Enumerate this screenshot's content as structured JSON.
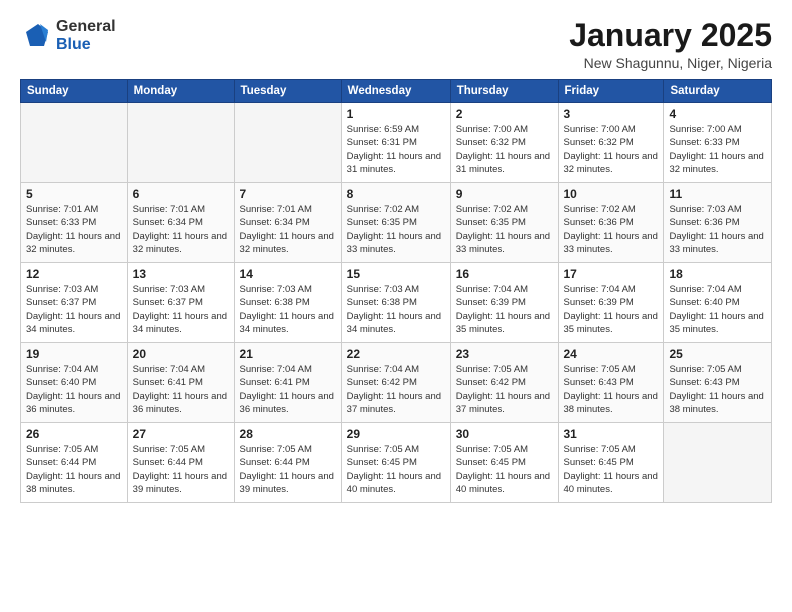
{
  "header": {
    "logo_general": "General",
    "logo_blue": "Blue",
    "month_title": "January 2025",
    "location": "New Shagunnu, Niger, Nigeria"
  },
  "days_of_week": [
    "Sunday",
    "Monday",
    "Tuesday",
    "Wednesday",
    "Thursday",
    "Friday",
    "Saturday"
  ],
  "weeks": [
    [
      {
        "num": "",
        "empty": true
      },
      {
        "num": "",
        "empty": true
      },
      {
        "num": "",
        "empty": true
      },
      {
        "num": "1",
        "sunrise": "6:59 AM",
        "sunset": "6:31 PM",
        "daylight": "11 hours and 31 minutes."
      },
      {
        "num": "2",
        "sunrise": "7:00 AM",
        "sunset": "6:32 PM",
        "daylight": "11 hours and 31 minutes."
      },
      {
        "num": "3",
        "sunrise": "7:00 AM",
        "sunset": "6:32 PM",
        "daylight": "11 hours and 32 minutes."
      },
      {
        "num": "4",
        "sunrise": "7:00 AM",
        "sunset": "6:33 PM",
        "daylight": "11 hours and 32 minutes."
      }
    ],
    [
      {
        "num": "5",
        "sunrise": "7:01 AM",
        "sunset": "6:33 PM",
        "daylight": "11 hours and 32 minutes."
      },
      {
        "num": "6",
        "sunrise": "7:01 AM",
        "sunset": "6:34 PM",
        "daylight": "11 hours and 32 minutes."
      },
      {
        "num": "7",
        "sunrise": "7:01 AM",
        "sunset": "6:34 PM",
        "daylight": "11 hours and 32 minutes."
      },
      {
        "num": "8",
        "sunrise": "7:02 AM",
        "sunset": "6:35 PM",
        "daylight": "11 hours and 33 minutes."
      },
      {
        "num": "9",
        "sunrise": "7:02 AM",
        "sunset": "6:35 PM",
        "daylight": "11 hours and 33 minutes."
      },
      {
        "num": "10",
        "sunrise": "7:02 AM",
        "sunset": "6:36 PM",
        "daylight": "11 hours and 33 minutes."
      },
      {
        "num": "11",
        "sunrise": "7:03 AM",
        "sunset": "6:36 PM",
        "daylight": "11 hours and 33 minutes."
      }
    ],
    [
      {
        "num": "12",
        "sunrise": "7:03 AM",
        "sunset": "6:37 PM",
        "daylight": "11 hours and 34 minutes."
      },
      {
        "num": "13",
        "sunrise": "7:03 AM",
        "sunset": "6:37 PM",
        "daylight": "11 hours and 34 minutes."
      },
      {
        "num": "14",
        "sunrise": "7:03 AM",
        "sunset": "6:38 PM",
        "daylight": "11 hours and 34 minutes."
      },
      {
        "num": "15",
        "sunrise": "7:03 AM",
        "sunset": "6:38 PM",
        "daylight": "11 hours and 34 minutes."
      },
      {
        "num": "16",
        "sunrise": "7:04 AM",
        "sunset": "6:39 PM",
        "daylight": "11 hours and 35 minutes."
      },
      {
        "num": "17",
        "sunrise": "7:04 AM",
        "sunset": "6:39 PM",
        "daylight": "11 hours and 35 minutes."
      },
      {
        "num": "18",
        "sunrise": "7:04 AM",
        "sunset": "6:40 PM",
        "daylight": "11 hours and 35 minutes."
      }
    ],
    [
      {
        "num": "19",
        "sunrise": "7:04 AM",
        "sunset": "6:40 PM",
        "daylight": "11 hours and 36 minutes."
      },
      {
        "num": "20",
        "sunrise": "7:04 AM",
        "sunset": "6:41 PM",
        "daylight": "11 hours and 36 minutes."
      },
      {
        "num": "21",
        "sunrise": "7:04 AM",
        "sunset": "6:41 PM",
        "daylight": "11 hours and 36 minutes."
      },
      {
        "num": "22",
        "sunrise": "7:04 AM",
        "sunset": "6:42 PM",
        "daylight": "11 hours and 37 minutes."
      },
      {
        "num": "23",
        "sunrise": "7:05 AM",
        "sunset": "6:42 PM",
        "daylight": "11 hours and 37 minutes."
      },
      {
        "num": "24",
        "sunrise": "7:05 AM",
        "sunset": "6:43 PM",
        "daylight": "11 hours and 38 minutes."
      },
      {
        "num": "25",
        "sunrise": "7:05 AM",
        "sunset": "6:43 PM",
        "daylight": "11 hours and 38 minutes."
      }
    ],
    [
      {
        "num": "26",
        "sunrise": "7:05 AM",
        "sunset": "6:44 PM",
        "daylight": "11 hours and 38 minutes."
      },
      {
        "num": "27",
        "sunrise": "7:05 AM",
        "sunset": "6:44 PM",
        "daylight": "11 hours and 39 minutes."
      },
      {
        "num": "28",
        "sunrise": "7:05 AM",
        "sunset": "6:44 PM",
        "daylight": "11 hours and 39 minutes."
      },
      {
        "num": "29",
        "sunrise": "7:05 AM",
        "sunset": "6:45 PM",
        "daylight": "11 hours and 40 minutes."
      },
      {
        "num": "30",
        "sunrise": "7:05 AM",
        "sunset": "6:45 PM",
        "daylight": "11 hours and 40 minutes."
      },
      {
        "num": "31",
        "sunrise": "7:05 AM",
        "sunset": "6:45 PM",
        "daylight": "11 hours and 40 minutes."
      },
      {
        "num": "",
        "empty": true
      }
    ]
  ]
}
